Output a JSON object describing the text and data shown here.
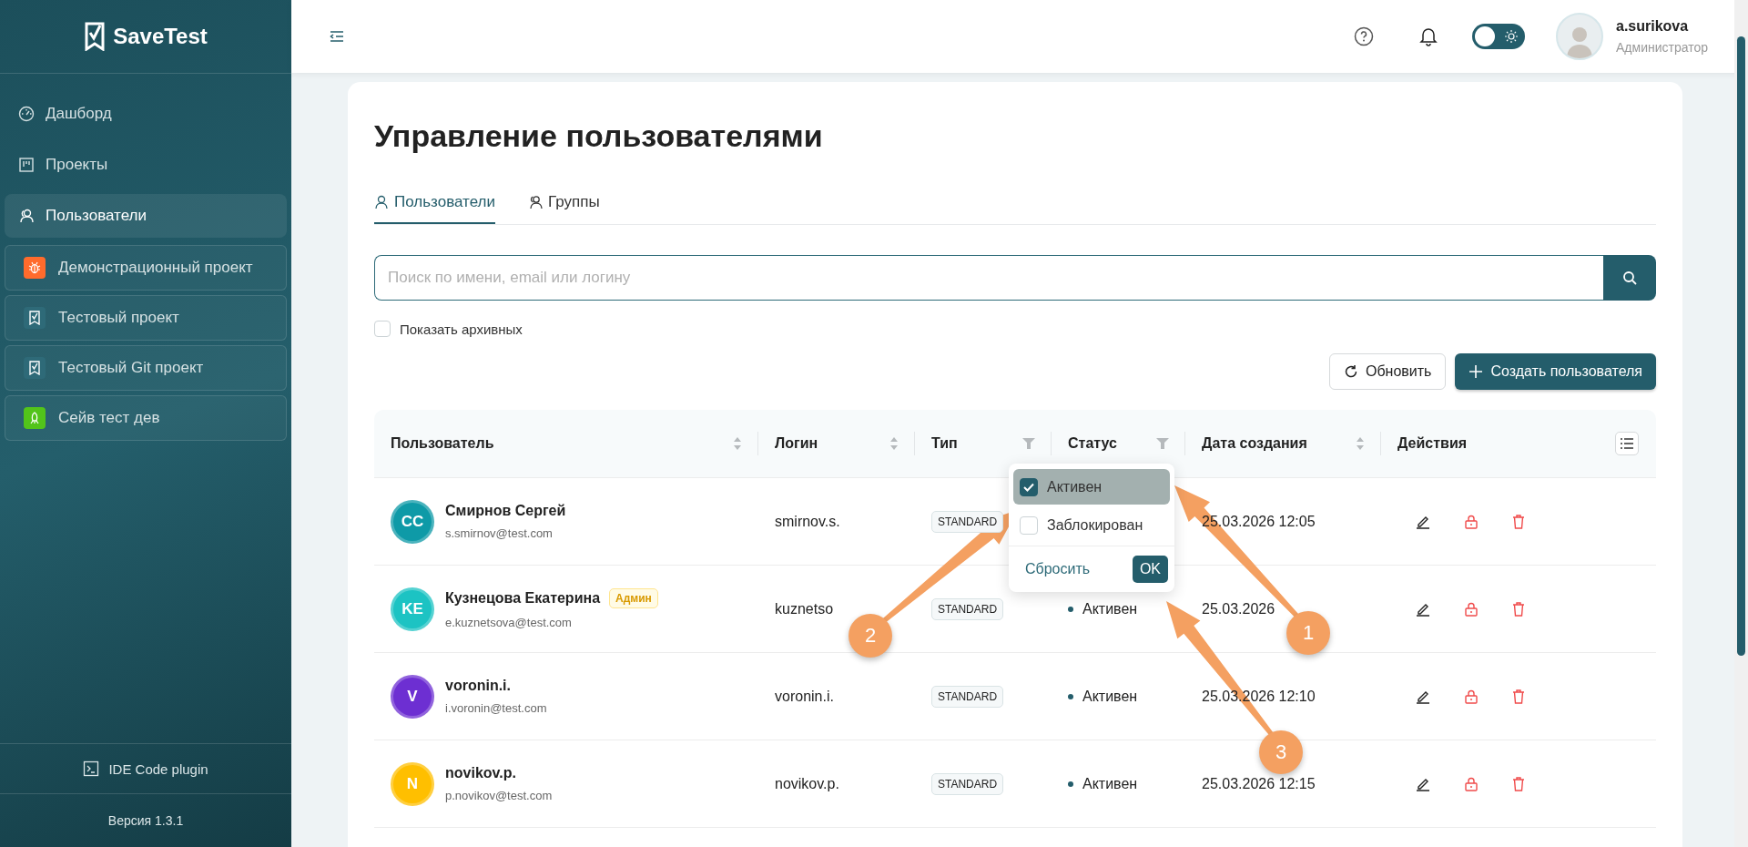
{
  "sidebar": {
    "logo": "SaveTest",
    "nav": [
      {
        "label": "Дашборд",
        "selected": false
      },
      {
        "label": "Проекты",
        "selected": false
      },
      {
        "label": "Пользователи",
        "selected": true
      }
    ],
    "projects": [
      {
        "name": "Демонстрационный проект",
        "color": "#ff6b2c"
      },
      {
        "name": "Тестовый проект",
        "color": "#2e6a78"
      },
      {
        "name": "Тестовый Git проект",
        "color": "#2e6a78"
      },
      {
        "name": "Сейв тест дев",
        "color": "#52c41a"
      }
    ],
    "plugin": "IDE Code plugin",
    "version": "Версия 1.3.1"
  },
  "header": {
    "theme_toggle": {
      "on": false
    },
    "user": {
      "name": "a.surikova",
      "role": "Администратор"
    }
  },
  "page": {
    "title": "Управление пользователями",
    "tabs": [
      {
        "label": "Пользователи",
        "selected": true
      },
      {
        "label": "Группы",
        "selected": false
      }
    ],
    "search": {
      "placeholder": "Поиск по имени, email или логину"
    },
    "show_archived": {
      "label": "Показать архивных",
      "checked": false
    },
    "buttons": [
      {
        "kind": "refresh",
        "label": "Обновить"
      },
      {
        "kind": "create",
        "label": "Создать пользователя"
      }
    ]
  },
  "table": {
    "columns": [
      {
        "label": "Пользователь",
        "kind": "sortable"
      },
      {
        "label": "Логин",
        "kind": "sortable"
      },
      {
        "label": "Тип",
        "kind": "filterable"
      },
      {
        "label": "Статус",
        "kind": "filterable"
      },
      {
        "label": "Дата создания",
        "kind": "sortable"
      },
      {
        "label": "Действия",
        "kind": "plain"
      }
    ],
    "rows": [
      {
        "initials": "CC",
        "color": "#0e9aa7",
        "name": "Смирнов Сергей",
        "email": "s.smirnov@test.com",
        "login": "smirnov.s.",
        "type": "STANDARD",
        "date": "25.03.2026 12:05"
      },
      {
        "initials": "KE",
        "color": "#1cc3c3",
        "name": "Кузнецова Екатерина",
        "badge": "Админ",
        "email": "e.kuznetsova@test.com",
        "login": "kuznetso",
        "type": "STANDARD",
        "status": "Активен",
        "date": "25.03.2026"
      },
      {
        "initials": "V",
        "color": "#6d2fd2",
        "name": "voronin.i.",
        "email": "i.voronin@test.com",
        "login": "voronin.i.",
        "type": "STANDARD",
        "status": "Активен",
        "date": "25.03.2026 12:10"
      },
      {
        "initials": "N",
        "color": "#ffbf00",
        "name": "novikov.p.",
        "email": "p.novikov@test.com",
        "login": "novikov.p.",
        "type": "STANDARD",
        "status": "Активен",
        "date": "25.03.2026 12:15"
      }
    ]
  },
  "status_filter": {
    "options": [
      {
        "label": "Активен",
        "checked": true
      },
      {
        "label": "Заблокирован",
        "checked": false
      }
    ],
    "reset": "Сбросить",
    "ok": "OK"
  },
  "annotations": [
    {
      "number": "1"
    },
    {
      "number": "2"
    },
    {
      "number": "3"
    }
  ]
}
